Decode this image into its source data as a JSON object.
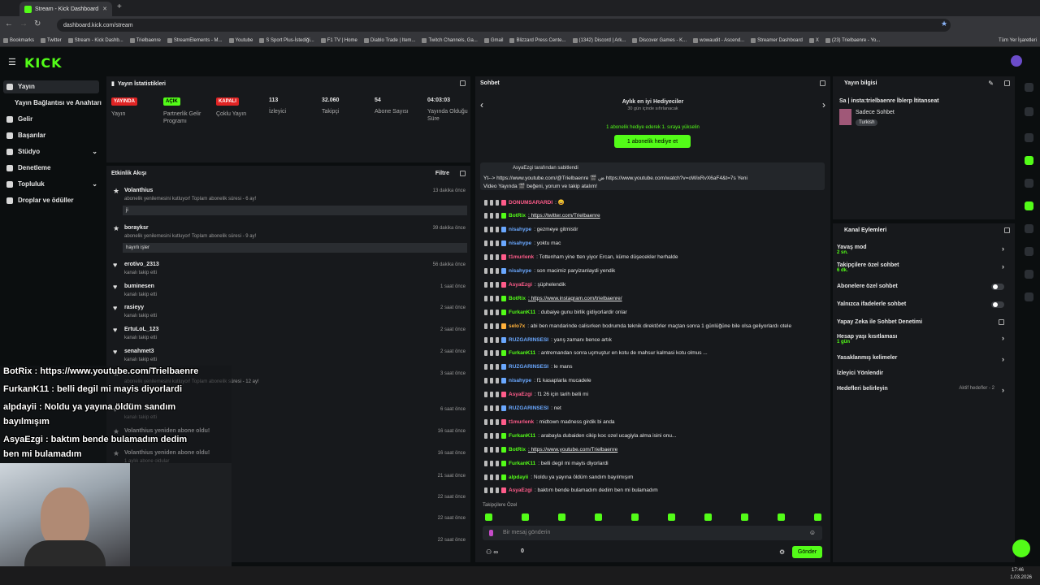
{
  "browser": {
    "tab_title": "Stream - Kick Dashboard",
    "url": "dashboard.kick.com/stream",
    "bookmarks": [
      "Bookmarks",
      "Twitter",
      "Stream - Kick Dashb...",
      "Trielbaenre",
      "StreamElements - M...",
      "Youtube",
      "S Sport Plus-İstediği...",
      "F1 TV | Home",
      "Diablo Trade | Item...",
      "Twitch Channels, Ga...",
      "Gmail",
      "Blizzard Press Cente...",
      "(1342) Discord | Ark...",
      "Discover Games - K...",
      "wowaudit - Ascend...",
      "Streamer Dashboard",
      "X",
      "(23) Trielbaenre - Yo..."
    ],
    "all_bookmarks": "Tüm Yer İşaretleri"
  },
  "brand": {
    "logo": "KICK",
    "accent": "#53fc18"
  },
  "sidebar": {
    "items": [
      {
        "label": "Yayın",
        "icon": "broadcast-icon"
      },
      {
        "label": "Yayın Bağlantısı ve Anahtarı",
        "icon": ""
      },
      {
        "label": "Gelir",
        "icon": "money-icon"
      },
      {
        "label": "Başarılar",
        "icon": "trophy-icon"
      },
      {
        "label": "Stüdyo",
        "icon": "studio-icon"
      },
      {
        "label": "Denetleme",
        "icon": "shield-icon"
      },
      {
        "label": "Topluluk",
        "icon": "community-icon"
      },
      {
        "label": "Droplar ve ödüller",
        "icon": "gift-icon"
      }
    ]
  },
  "stats": {
    "title": "Yayın İstatistikleri",
    "items": [
      {
        "badge": "YAYINDA",
        "label": "Yayın",
        "color": "#e02424"
      },
      {
        "badge": "AÇIK",
        "label": "Partnerlik Gelir Programı",
        "color": "#53fc18"
      },
      {
        "badge": "KAPALI",
        "label": "Çoklu Yayın",
        "color": "#e02424"
      },
      {
        "value": "113",
        "label": "İzleyici"
      },
      {
        "value": "32.060",
        "label": "Takipçi"
      },
      {
        "value": "54",
        "label": "Abone Sayısı"
      },
      {
        "value": "04:03:03",
        "label": "Yayında Olduğu Süre"
      }
    ]
  },
  "activity": {
    "title": "Etkinlik Akışı",
    "filter": "Filtre",
    "rows": [
      {
        "name": "Volanthius",
        "sub": "abonelik yenilemesini kutluyor! Toplam abonelik süresi - 6 ay!",
        "time": "13 dakika önce",
        "msg": "ji"
      },
      {
        "name": "borayksr",
        "sub": "abonelik yenilemesini kutluyor! Toplam abonelik süresi - 9 ay!",
        "time": "39 dakika önce",
        "msg": "hayırlı işler"
      },
      {
        "name": "erotivo_2313",
        "sub": "kanalı takip etti",
        "time": "56 dakika önce"
      },
      {
        "name": "buminesen",
        "sub": "kanalı takip etti",
        "time": "1 saat önce"
      },
      {
        "name": "rasieyy",
        "sub": "kanalı takip etti",
        "time": "2 saat önce"
      },
      {
        "name": "ErtuLoL_123",
        "sub": "kanalı takip etti",
        "time": "2 saat önce"
      },
      {
        "name": "senahmet3",
        "sub": "kanalı takip etti",
        "time": "2 saat önce"
      },
      {
        "name": "",
        "sub": "abonelik yenilemesini kutluyor! Toplam abonelik süresi - 12 ay!",
        "time": "3 saat önce"
      },
      {
        "name": "",
        "sub": "kanalı takip etti",
        "time": "6 saat önce"
      },
      {
        "name": "Volanthius yeniden abone oldu!",
        "sub": "",
        "time": "16 saat önce"
      },
      {
        "name": "Volanthius yeniden abone oldu!",
        "sub": "1 aylık abone oldular",
        "time": "16 saat önce"
      },
      {
        "name": "",
        "sub": "",
        "time": "21 saat önce"
      },
      {
        "name": "",
        "sub": "",
        "time": "22 saat önce"
      },
      {
        "name": "",
        "sub": "",
        "time": "22 saat önce"
      },
      {
        "name": "",
        "sub": "",
        "time": "22 saat önce"
      }
    ]
  },
  "chat": {
    "title": "Sohbet",
    "gifters_title": "Aylık en iyi Hediyeciler",
    "gifters_sub": "30 gün içinde sıfırlanacak",
    "gift_note": "1 abonelik hediye ederek 1. sıraya yükselin",
    "gift_button": "1 abonelik hediye et",
    "pinned_by": "AsyaEzgi tarafından sabitlendi",
    "pinned_text_1": "Yt--> https://www.youtube.com/@Trielbaenre 🎬 ض https://www.youtube.com/watch?v=oWixRvX6aF4&t=7s Yeni",
    "pinned_text_2": "Video Yayında 🎬 beğeni, yorum ve takip atalım!",
    "messages": [
      {
        "user": "DONUMSARARDI",
        "color": "#ff5c8a",
        "text": ": 😄"
      },
      {
        "user": "BotRix",
        "color": "#53fc18",
        "text": ": https://twitter.com/Trielbaenre",
        "link": true
      },
      {
        "user": "nisahype",
        "color": "#6aa8ff",
        "text": ": gezmeye gitmistir"
      },
      {
        "user": "nisahype",
        "color": "#6aa8ff",
        "text": ": yoktu mac"
      },
      {
        "user": "t1murlenk",
        "color": "#ff5c8a",
        "text": ": Tottenham yine tten yiyor Ercan, küme düşecekler herhalde"
      },
      {
        "user": "nisahype",
        "color": "#6aa8ff",
        "text": ": son macimiz paryizanlaydi yendik"
      },
      {
        "user": "AsyaEzgi",
        "color": "#ff5c8a",
        "text": ": şüphelendik"
      },
      {
        "user": "BotRix",
        "color": "#53fc18",
        "text": ": https://www.instagram.com/trielbaenre/",
        "link": true
      },
      {
        "user": "FurkanK11",
        "color": "#53fc18",
        "text": ": dubaiye gunu birlik gidiyorlardir onlar"
      },
      {
        "user": "selo7x",
        "color": "#ffb13b",
        "text": ": abi ben mandarinde calisırken bodrumda teknik direktörler maçtan sonra 1 günlüğüne bile olsa geliyorlardı otele"
      },
      {
        "user": "RUZGARINSESI",
        "color": "#6aa8ff",
        "text": ": yarış zamanı bence artık"
      },
      {
        "user": "FurkanK11",
        "color": "#53fc18",
        "text": ": antremandan sonra uçmuştur en kotu de mahsur kalmasi kotu olmus ..."
      },
      {
        "user": "RUZGARINSESI",
        "color": "#6aa8ff",
        "text": ": le mans"
      },
      {
        "user": "nisahype",
        "color": "#6aa8ff",
        "text": ": f1 kasaplarla mucadele"
      },
      {
        "user": "AsyaEzgi",
        "color": "#ff5c8a",
        "text": ": f1 26 için tarih belli mi"
      },
      {
        "user": "RUZGARINSESI",
        "color": "#6aa8ff",
        "text": ": net"
      },
      {
        "user": "t1murlenk",
        "color": "#ff5c8a",
        "text": ": midtown madness girdik bi anda"
      },
      {
        "user": "FurkanK11",
        "color": "#53fc18",
        "text": ": arabayla dubaiden cikip koc ozel ucagiyla alma isini onu..."
      },
      {
        "user": "BotRix",
        "color": "#53fc18",
        "text": ": https://www.youtube.com/Trielbaenre",
        "link": true
      },
      {
        "user": "FurkanK11",
        "color": "#53fc18",
        "text": ": belli degil mi mayis diyorlardi"
      },
      {
        "user": "alpdayii",
        "color": "#53fc18",
        "text": ": Noldu ya yayına öldüm sandım bayılmışım"
      },
      {
        "user": "AsyaEzgi",
        "color": "#ff5c8a",
        "text": ": baktım bende bulamadım dedim ben mi bulamadım"
      }
    ],
    "follower_only": "Takipçilere Özel",
    "input_placeholder": "Bir mesaj gönderin",
    "count": "0",
    "send": "Gönder"
  },
  "stream_info": {
    "title": "Yayın bilgisi",
    "stream_title": "Sa | insta:trielbaenre İblerp İtitanseat",
    "category": "Sadece Sohbet",
    "tag": "Turkish"
  },
  "channel_actions": {
    "title": "Kanal Eylemleri",
    "items": [
      {
        "label": "Yavaş mod",
        "sub": "2 sn.",
        "type": "chevron"
      },
      {
        "label": "Takipçilere özel sohbet",
        "sub": "6 dk.",
        "type": "chevron"
      },
      {
        "label": "Abonelere özel sohbet",
        "type": "toggle"
      },
      {
        "label": "Yalnızca ifadelerle sohbet",
        "type": "toggle"
      },
      {
        "label": "Yapay Zeka ile Sohbet Denetimi",
        "type": "external"
      },
      {
        "label": "Hesap yaşı kısıtlaması",
        "sub": "1 gün",
        "type": "chevron"
      },
      {
        "label": "Yasaklanmış kelimeler",
        "type": "chevron"
      },
      {
        "label": "İzleyici Yönlendir",
        "type": "none"
      },
      {
        "label": "Hedefleri belirleyin",
        "extra": "Aktif hedefler - 2",
        "type": "chevron"
      }
    ]
  },
  "overlay": {
    "lines": [
      "BotRix : https://www.youtube.com/Trielbaenre",
      "FurkanK11 : belli degil mi mayis diyorlardi",
      "alpdayii : Noldu ya yayına öldüm sandım",
      "bayılmışım",
      "AsyaEzgi : baktım bende bulamadım dedim",
      "ben mi bulamadım"
    ]
  },
  "taskbar": {
    "time": "17:46",
    "date": "1.03.2026"
  }
}
